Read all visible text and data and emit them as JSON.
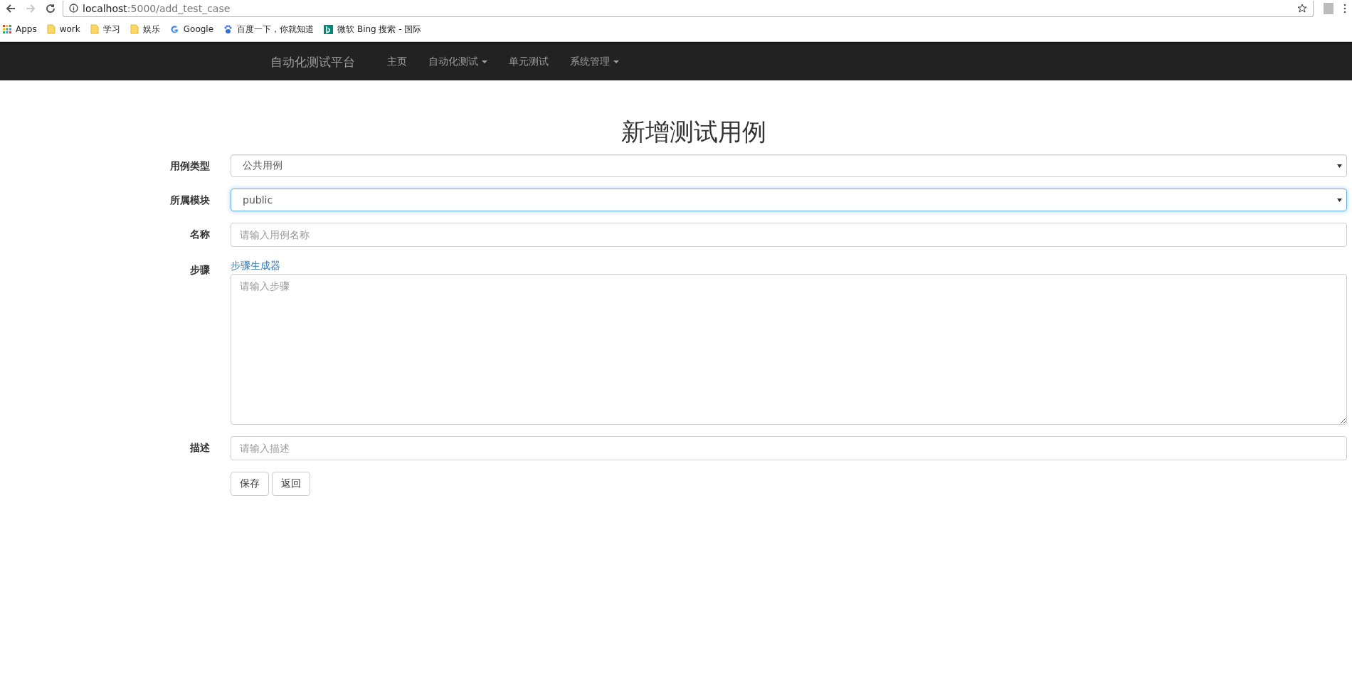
{
  "browser": {
    "url_host": "localhost",
    "url_path": ":5000/add_test_case"
  },
  "bookmarks": [
    {
      "kind": "apps",
      "label": "Apps"
    },
    {
      "kind": "folder",
      "label": "work"
    },
    {
      "kind": "folder",
      "label": "学习"
    },
    {
      "kind": "folder",
      "label": "娱乐"
    },
    {
      "kind": "google",
      "label": "Google"
    },
    {
      "kind": "baidu",
      "label": "百度一下，你就知道"
    },
    {
      "kind": "bing",
      "label": "微软 Bing 搜索 - 国际"
    }
  ],
  "navbar": {
    "brand": "自动化测试平台",
    "items": [
      {
        "label": "主页",
        "dropdown": false
      },
      {
        "label": "自动化测试",
        "dropdown": true
      },
      {
        "label": "单元测试",
        "dropdown": false
      },
      {
        "label": "系统管理",
        "dropdown": true
      }
    ]
  },
  "form": {
    "title": "新增测试用例",
    "fields": [
      {
        "kind": "select",
        "label": "用例类型",
        "value": "公共用例",
        "focused": false
      },
      {
        "kind": "select",
        "label": "所属模块",
        "value": "public",
        "focused": true
      },
      {
        "kind": "text",
        "label": "名称",
        "placeholder": "请输入用例名称",
        "focused": false
      },
      {
        "kind": "textarea",
        "label": "步骤",
        "link": "步骤生成器",
        "placeholder": "请输入步骤",
        "focused": false
      },
      {
        "kind": "text",
        "label": "描述",
        "placeholder": "请输入描述",
        "focused": false
      }
    ],
    "buttons": [
      "保存",
      "返回"
    ]
  }
}
